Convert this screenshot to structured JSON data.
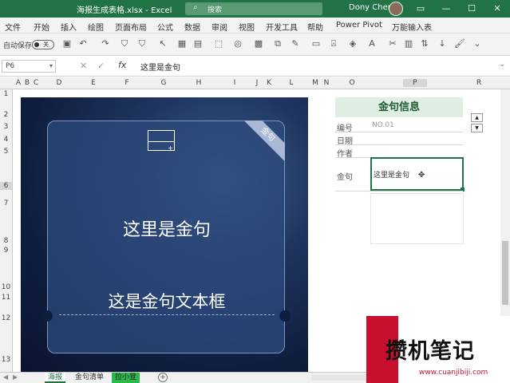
{
  "titlebar": {
    "title": "海报生成表格.xlsx - Excel",
    "search_placeholder": "搜索",
    "user": "Dony Chen",
    "window_buttons": [
      "▭",
      "—",
      "☐",
      "✕"
    ]
  },
  "menu": [
    "文件",
    "开始",
    "插入",
    "绘图",
    "页面布局",
    "公式",
    "数据",
    "审阅",
    "视图",
    "开发工具",
    "帮助",
    "Power Pivot",
    "万能输入表"
  ],
  "qat": {
    "autosave_label": "自动保存",
    "autosave_state": "关"
  },
  "formula_bar": {
    "name_box": "P6",
    "fx": "fx",
    "value": "这里是金句"
  },
  "columns": [
    "A",
    "B",
    "C",
    "D",
    "E",
    "F",
    "G",
    "H",
    "I",
    "J",
    "K",
    "L",
    "M",
    "N",
    "O",
    "P",
    "R"
  ],
  "rows": [
    "1",
    "2",
    "3",
    "4",
    "5",
    "6",
    "7",
    "8",
    "9",
    "10",
    "11",
    "12",
    "13"
  ],
  "poster": {
    "ribbon": "金句",
    "quote": "这里是金句",
    "textbox": "这是金句文本框"
  },
  "info_panel": {
    "title": "金句信息",
    "fields": [
      {
        "label": "编号",
        "value": "NO.01"
      },
      {
        "label": "日期",
        "value": ""
      },
      {
        "label": "作者",
        "value": ""
      },
      {
        "label": "金句",
        "value": "这里是金句"
      }
    ]
  },
  "sheet_tabs": [
    {
      "label": "海报",
      "active": true
    },
    {
      "label": "金句清单",
      "active": false
    },
    {
      "label": "拉小登",
      "active": false
    }
  ],
  "watermark": {
    "text": "攒机笔记",
    "url": "www.cuanjibiji.com"
  },
  "colors": {
    "excel_green": "#217346",
    "poster_blue": "#1f3560",
    "info_bg": "#dfeee2",
    "watermark_red": "#c8102e"
  }
}
